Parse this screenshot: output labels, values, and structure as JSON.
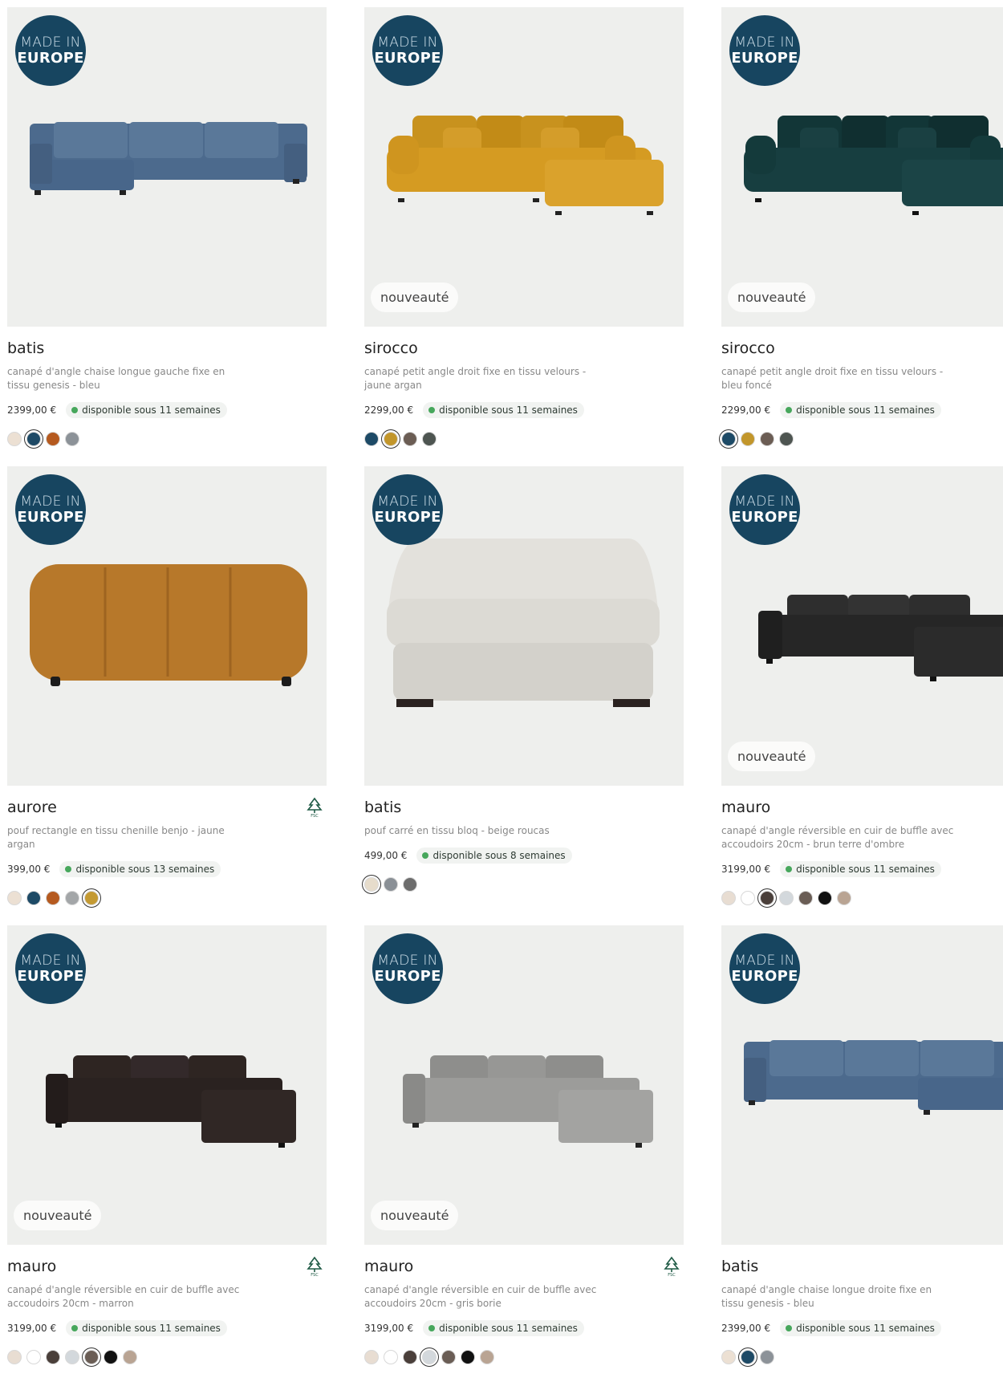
{
  "badge": {
    "line1": "MADE IN",
    "line2": "EUROPE"
  },
  "new_label": "nouveauté",
  "products": [
    {
      "name": "batis",
      "desc": "canapé d'angle chaise longue gauche fixe en tissu genesis - bleu",
      "price": "2399,00 €",
      "availability": "disponible sous 11 semaines",
      "is_new": false,
      "fsc": false,
      "swatches": [
        "#ece0d3",
        "#1e4a66",
        "#b55a1f",
        "#8c9298"
      ],
      "selected": 1
    },
    {
      "name": "sirocco",
      "desc": "canapé petit angle droit fixe en tissu velours - jaune argan",
      "price": "2299,00 €",
      "availability": "disponible sous 11 semaines",
      "is_new": true,
      "fsc": false,
      "swatches": [
        "#1d4a66",
        "#c2962b",
        "#6b5d54",
        "#4e5551"
      ],
      "selected": 1
    },
    {
      "name": "sirocco",
      "desc": "canapé petit angle droit fixe en tissu velours - bleu foncé",
      "price": "2299,00 €",
      "availability": "disponible sous 11 semaines",
      "is_new": true,
      "fsc": false,
      "swatches": [
        "#1d4a66",
        "#c2962b",
        "#6b5d54",
        "#4e5551"
      ],
      "selected": 0
    },
    {
      "name": "aurore",
      "desc": "pouf rectangle en tissu chenille benjo - jaune argan",
      "price": "399,00 €",
      "availability": "disponible sous 13 semaines",
      "is_new": false,
      "fsc": true,
      "swatches": [
        "#ece0d3",
        "#1d4a66",
        "#b55a1f",
        "#a3a6a8",
        "#c49a33"
      ],
      "selected": 4
    },
    {
      "name": "batis",
      "desc": "pouf carré en tissu bloq - beige roucas",
      "price": "499,00 €",
      "availability": "disponible sous 8 semaines",
      "is_new": false,
      "fsc": false,
      "swatches": [
        "#e6dccb",
        "#8a9096",
        "#6d6d6d"
      ],
      "selected": 0
    },
    {
      "name": "mauro",
      "desc": "canapé d'angle réversible en cuir de buffle avec accoudoirs 20cm - brun terre d'ombre",
      "price": "3199,00 €",
      "availability": "disponible sous 11 semaines",
      "is_new": true,
      "fsc": false,
      "swatches": [
        "#e8ddd2",
        "#ffffff",
        "#4a3f3a",
        "#d3d8dc",
        "#6a5d55",
        "#111111",
        "#b9a493"
      ],
      "selected": 2
    },
    {
      "name": "mauro",
      "desc": "canapé d'angle réversible en cuir de buffle avec accoudoirs 20cm - marron",
      "price": "3199,00 €",
      "availability": "disponible sous 11 semaines",
      "is_new": true,
      "fsc": true,
      "swatches": [
        "#e8ddd2",
        "#ffffff",
        "#4a3f3a",
        "#d3d8dc",
        "#6a5d55",
        "#111111",
        "#b9a493"
      ],
      "selected": 4
    },
    {
      "name": "mauro",
      "desc": "canapé d'angle réversible en cuir de buffle avec accoudoirs 20cm - gris borie",
      "price": "3199,00 €",
      "availability": "disponible sous 11 semaines",
      "is_new": true,
      "fsc": true,
      "swatches": [
        "#e8ddd2",
        "#ffffff",
        "#4a3f3a",
        "#d3d8dc",
        "#6a5d55",
        "#111111",
        "#b9a493"
      ],
      "selected": 3
    },
    {
      "name": "batis",
      "desc": "canapé d'angle chaise longue droite fixe en tissu genesis - bleu",
      "price": "2399,00 €",
      "availability": "disponible sous 11 semaines",
      "is_new": false,
      "fsc": false,
      "swatches": [
        "#ece0d3",
        "#1e4a66",
        "#8c9298"
      ],
      "selected": 1
    }
  ]
}
